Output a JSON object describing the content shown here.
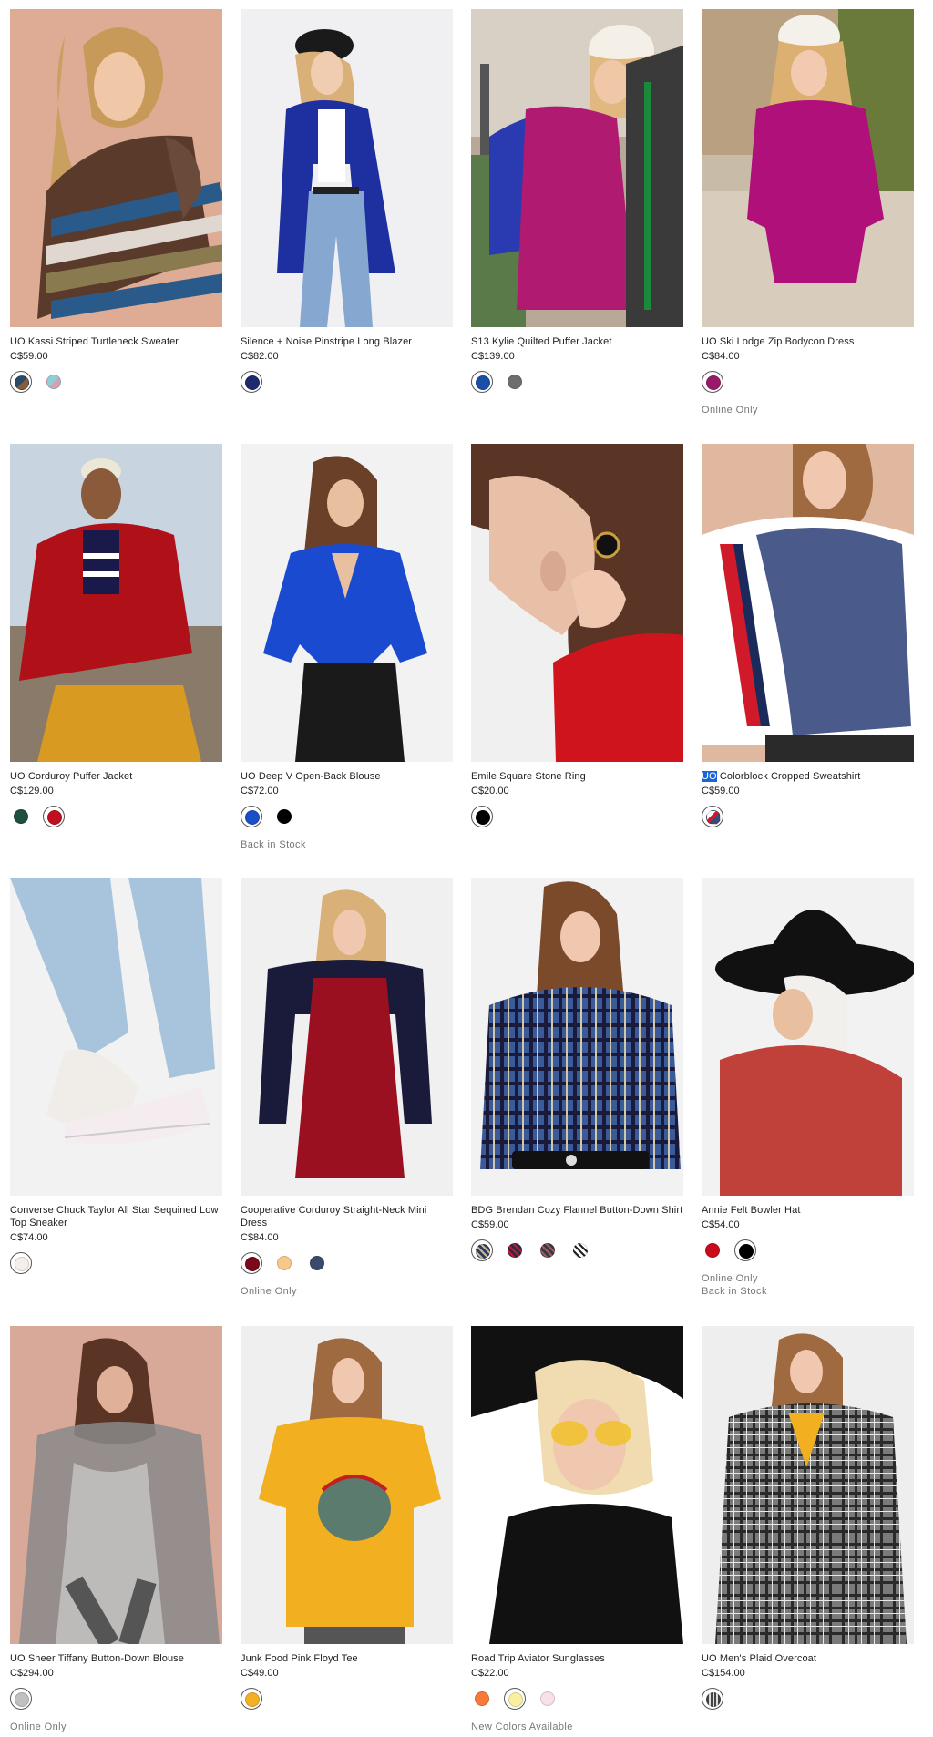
{
  "products": [
    {
      "name": "UO Kassi Striped Turtleneck Sweater",
      "price": "C$59.00",
      "swatches": [
        {
          "colors": [
            "#2a4a66",
            "#8a5a3a"
          ]
        },
        {
          "colors": [
            "#8fd0d8",
            "#d9a0b0"
          ]
        }
      ],
      "notes": []
    },
    {
      "name": "Silence + Noise Pinstripe Long Blazer",
      "price": "C$82.00",
      "swatches": [
        {
          "colors": [
            "#1e2a6b"
          ]
        }
      ],
      "notes": []
    },
    {
      "name": "S13 Kylie Quilted Puffer Jacket",
      "price": "C$139.00",
      "swatches": [
        {
          "colors": [
            "#1a4fa8"
          ]
        },
        {
          "colors": [
            "#6e6e6e"
          ]
        }
      ],
      "notes": []
    },
    {
      "name": "UO Ski Lodge Zip Bodycon Dress",
      "price": "C$84.00",
      "swatches": [
        {
          "colors": [
            "#9a1a6a"
          ]
        }
      ],
      "notes": [
        "Online Only"
      ]
    },
    {
      "name": "UO Corduroy Puffer Jacket",
      "price": "C$129.00",
      "swatches": [
        {
          "colors": [
            "#1f4f3f"
          ]
        },
        {
          "colors": [
            "#c01020"
          ]
        }
      ],
      "notes": []
    },
    {
      "name": "UO Deep V Open-Back Blouse",
      "price": "C$72.00",
      "swatches": [
        {
          "colors": [
            "#1a4fc8"
          ]
        },
        {
          "colors": [
            "#000000"
          ]
        }
      ],
      "notes": [
        "Back in Stock"
      ]
    },
    {
      "name": "Emile Square Stone Ring",
      "price": "C$20.00",
      "swatches": [
        {
          "colors": [
            "#000000"
          ]
        }
      ],
      "notes": []
    },
    {
      "name_highlight": "UO",
      "name": " Colorblock Cropped Sweatshirt",
      "price": "C$59.00",
      "swatches": [
        {
          "colors": [
            "#ffffff",
            "#d01a2a",
            "#3a4a7a"
          ]
        }
      ],
      "notes": []
    },
    {
      "name": "Converse Chuck Taylor All Star Sequined Low Top Sneaker",
      "price": "C$74.00",
      "swatches": [
        {
          "colors": [
            "#f4efea"
          ]
        }
      ],
      "notes": []
    },
    {
      "name": "Cooperative Corduroy Straight-Neck Mini Dress",
      "price": "C$84.00",
      "swatches": [
        {
          "colors": [
            "#7a0a1a"
          ]
        },
        {
          "colors": [
            "#f8c88a"
          ]
        },
        {
          "colors": [
            "#3a4a6a"
          ]
        }
      ],
      "notes": [
        "Online Only"
      ]
    },
    {
      "name": "BDG Brendan Cozy Flannel Button-Down Shirt",
      "price": "C$59.00",
      "swatches": [
        {
          "colors": [
            "#2a3a6a",
            "#c8b890"
          ]
        },
        {
          "colors": [
            "#2a2a4a",
            "#c01a2a"
          ]
        },
        {
          "colors": [
            "#3a3a3a",
            "#a05a6a"
          ]
        },
        {
          "colors": [
            "#ffffff",
            "#222222"
          ]
        }
      ],
      "notes": []
    },
    {
      "name": "Annie Felt Bowler Hat",
      "price": "C$54.00",
      "swatches": [
        {
          "colors": [
            "#c80a1a"
          ]
        },
        {
          "colors": [
            "#000000"
          ]
        }
      ],
      "notes": [
        "Online Only",
        "Back in Stock"
      ]
    },
    {
      "name": "UO Sheer Tiffany Button-Down Blouse",
      "price": "C$294.00",
      "swatches": [
        {
          "colors": [
            "#c0c0c0"
          ]
        }
      ],
      "notes": [
        "Online Only"
      ]
    },
    {
      "name": "Junk Food Pink Floyd Tee",
      "price": "C$49.00",
      "swatches": [
        {
          "colors": [
            "#f2b025"
          ]
        }
      ],
      "notes": []
    },
    {
      "name": "Road Trip Aviator Sunglasses",
      "price": "C$22.00",
      "swatches": [
        {
          "colors": [
            "#f87a3a"
          ]
        },
        {
          "colors": [
            "#f8f0a0"
          ]
        },
        {
          "colors": [
            "#f8e0e8"
          ]
        }
      ],
      "notes": [
        "New Colors Available"
      ]
    },
    {
      "name": "UO Men's Plaid Overcoat",
      "price": "C$154.00",
      "swatches": [
        {
          "colors": [
            "#444444",
            "#dddddd"
          ]
        }
      ],
      "notes": []
    }
  ]
}
